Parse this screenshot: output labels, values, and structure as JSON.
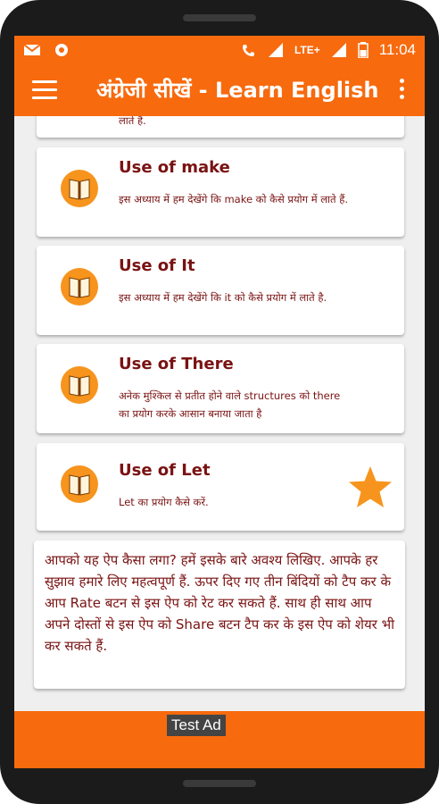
{
  "status": {
    "icons": [
      "gmail-icon",
      "circle-icon",
      "wifi-call-icon",
      "signal-icon",
      "lte-icon",
      "signal-icon",
      "battery-icon"
    ],
    "network": "LTE+",
    "time": "11:04"
  },
  "appbar": {
    "title": "अंग्रेजी सीखें - Learn English"
  },
  "partial_card": {
    "desc": "लाते हैं."
  },
  "cards": [
    {
      "title": "Use of make",
      "desc": "इस अध्याय में हम देखेंगे कि make को कैसे प्रयोग में लाते हैं.",
      "starred": false
    },
    {
      "title": "Use of It",
      "desc": "इस अध्याय में हम देखेंगे कि it को कैसे प्रयोग में लाते है.",
      "starred": false
    },
    {
      "title": "Use of There",
      "desc": "अनेक मुश्किल से प्रतीत होने वाले structures को there का प्रयोग करके आसान बनाया जाता है",
      "starred": false
    },
    {
      "title": "Use of Let",
      "desc": "Let का प्रयोग कैसे करें.",
      "starred": true
    }
  ],
  "note": {
    "text": "आपको यह ऐप कैसा लगा? हमें इसके बारे अवश्य लिखिए. आपके हर सुझाव हमारे लिए महत्वपूर्ण हैं. ऊपर दिए गए तीन बिंदियों को टैप कर के आप Rate बटन से इस ऐप को रेट कर सकते हैं. साथ ही साथ आप अपने दोस्तों से इस ऐप को Share बटन टैप कर के इस ऐप को शेयर भी कर सकते हैं."
  },
  "ad": {
    "label": "Test Ad"
  },
  "colors": {
    "accent": "#f76a0e",
    "text": "#7a1212",
    "star": "#f7941d"
  }
}
